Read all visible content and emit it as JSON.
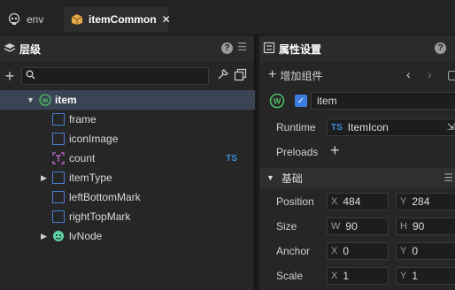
{
  "tabs": [
    {
      "label": "env",
      "icon": "skull-icon"
    },
    {
      "label": "itemCommon",
      "icon": "package-icon",
      "close": "✕"
    }
  ],
  "hierarchy": {
    "title": "层级",
    "search_value": "",
    "nodes": [
      {
        "label": "item",
        "expanded": true,
        "badge": ""
      },
      {
        "label": "frame",
        "badge": ""
      },
      {
        "label": "iconImage",
        "badge": ""
      },
      {
        "label": "count",
        "badge": "TS"
      },
      {
        "label": "itemType",
        "badge": ""
      },
      {
        "label": "leftBottomMark",
        "badge": ""
      },
      {
        "label": "rightTopMark",
        "badge": ""
      },
      {
        "label": "lvNode",
        "badge": ""
      }
    ]
  },
  "inspector": {
    "title": "属性设置",
    "add_component": "增加组件",
    "node_name": "item",
    "runtime_label": "Runtime",
    "runtime_value": "ItemIcon",
    "runtime_ts": "TS",
    "preloads_label": "Preloads",
    "section_title": "基础",
    "props": [
      {
        "label": "Position",
        "a_axis": "X",
        "a": "484",
        "b_axis": "Y",
        "b": "284"
      },
      {
        "label": "Size",
        "a_axis": "W",
        "a": "90",
        "b_axis": "H",
        "b": "90"
      },
      {
        "label": "Anchor",
        "a_axis": "X",
        "a": "0",
        "b_axis": "Y",
        "b": "0"
      },
      {
        "label": "Scale",
        "a_axis": "X",
        "a": "1",
        "b_axis": "Y",
        "b": "1"
      }
    ]
  },
  "colors": {
    "accent_green": "#4fc26a",
    "selection": "#3b4454",
    "ts_blue": "#3d8fe0"
  }
}
